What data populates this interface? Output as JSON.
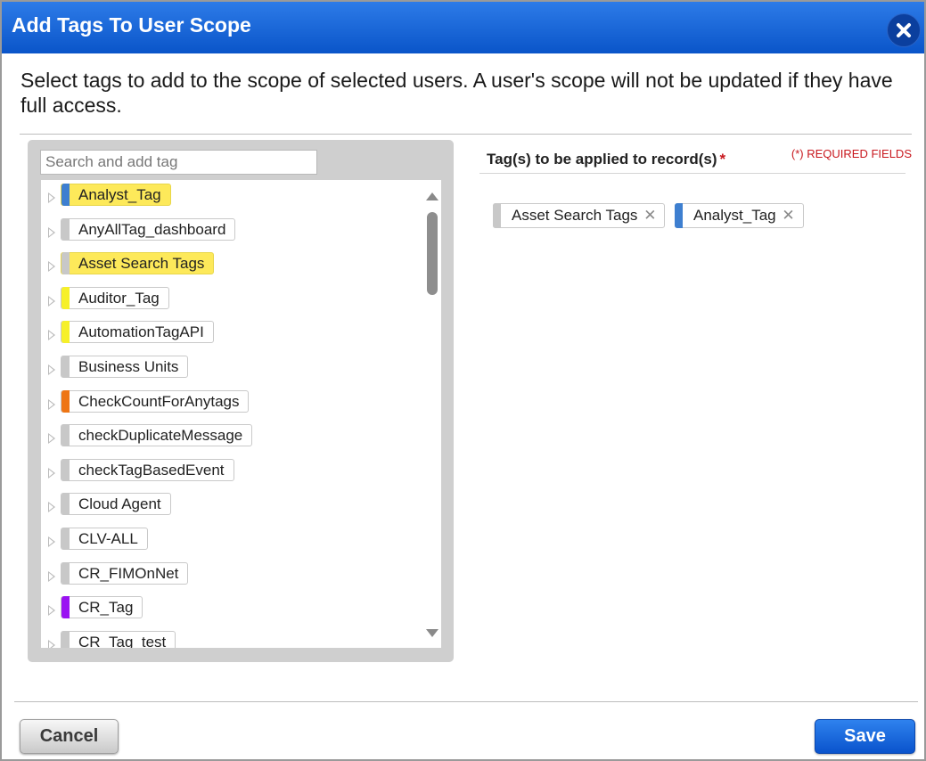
{
  "dialog": {
    "title": "Add Tags To User Scope",
    "close_icon": "close-icon",
    "intro": "Select tags to add to the scope of selected users. A user's scope will not be updated if they have full access."
  },
  "tree": {
    "search_placeholder": "Search and add tag",
    "items": [
      {
        "label": "Analyst_Tag",
        "color": "#3e7fd0",
        "highlight": true
      },
      {
        "label": "AnyAllTag_dashboard",
        "color": "#c8c8c8",
        "highlight": false
      },
      {
        "label": "Asset Search Tags",
        "color": "#c8c8c8",
        "highlight": true
      },
      {
        "label": "Auditor_Tag",
        "color": "#f6f02a",
        "highlight": false
      },
      {
        "label": "AutomationTagAPI",
        "color": "#f6f02a",
        "highlight": false
      },
      {
        "label": "Business Units",
        "color": "#c8c8c8",
        "highlight": false
      },
      {
        "label": "CheckCountForAnytags",
        "color": "#ee7514",
        "highlight": false
      },
      {
        "label": "checkDuplicateMessage",
        "color": "#c8c8c8",
        "highlight": false
      },
      {
        "label": "checkTagBasedEvent",
        "color": "#c8c8c8",
        "highlight": false
      },
      {
        "label": "Cloud Agent",
        "color": "#c8c8c8",
        "highlight": false
      },
      {
        "label": "CLV-ALL",
        "color": "#c8c8c8",
        "highlight": false
      },
      {
        "label": "CR_FIMOnNet",
        "color": "#c8c8c8",
        "highlight": false
      },
      {
        "label": "CR_Tag",
        "color": "#9a12f2",
        "highlight": false
      },
      {
        "label": "CR_Tag_test",
        "color": "#c8c8c8",
        "highlight": false
      }
    ]
  },
  "right_panel": {
    "title": "Tag(s) to be applied to record(s)",
    "required_star": "*",
    "required_note": "(*) REQUIRED FIELDS",
    "selected": [
      {
        "label": "Asset Search Tags",
        "color": "#c8c8c8",
        "remove": "✕"
      },
      {
        "label": "Analyst_Tag",
        "color": "#3e7fd0",
        "remove": "✕"
      }
    ]
  },
  "footer": {
    "cancel_label": "Cancel",
    "save_label": "Save"
  }
}
